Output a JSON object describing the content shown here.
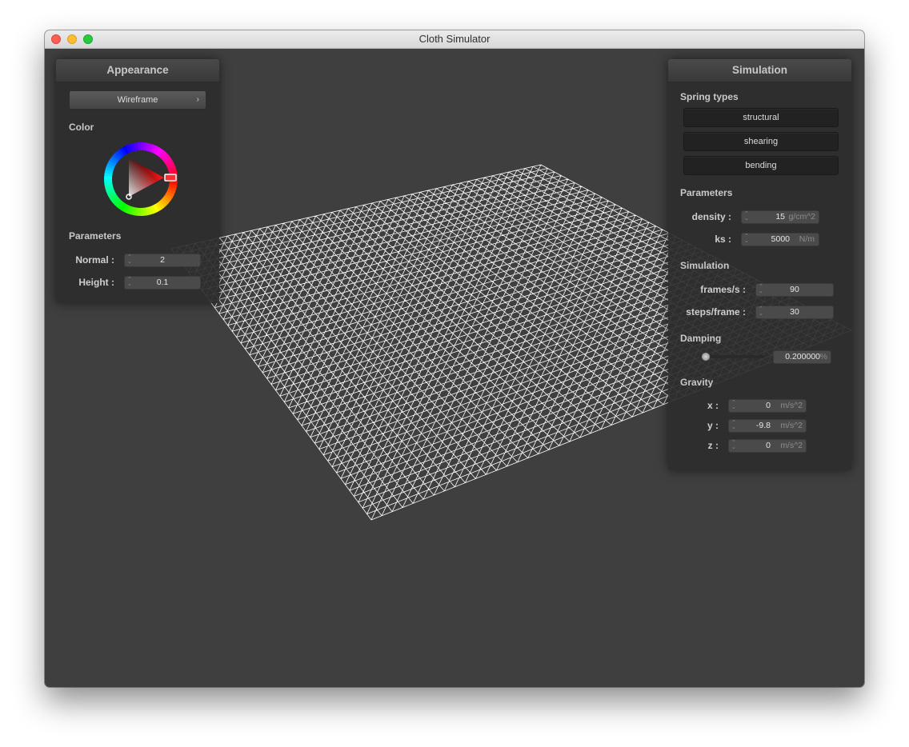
{
  "window": {
    "title": "Cloth Simulator"
  },
  "appearance": {
    "title": "Appearance",
    "shader_select": "Wireframe",
    "color_label": "Color",
    "params_label": "Parameters",
    "normal": {
      "label": "Normal :",
      "value": "2"
    },
    "height": {
      "label": "Height :",
      "value": "0.1"
    }
  },
  "simulation": {
    "title": "Simulation",
    "spring_types_label": "Spring types",
    "springs": [
      "structural",
      "shearing",
      "bending"
    ],
    "params_label": "Parameters",
    "density": {
      "label": "density :",
      "value": "15",
      "unit": "g/cm^2"
    },
    "ks": {
      "label": "ks :",
      "value": "5000",
      "unit": "N/m"
    },
    "sim_label": "Simulation",
    "frames": {
      "label": "frames/s :",
      "value": "90"
    },
    "steps": {
      "label": "steps/frame :",
      "value": "30"
    },
    "damping_label": "Damping",
    "damping": {
      "value": "0.200000",
      "unit": "%"
    },
    "gravity_label": "Gravity",
    "gx": {
      "label": "x :",
      "value": "0",
      "unit": "m/s^2"
    },
    "gy": {
      "label": "y :",
      "value": "-9.8",
      "unit": "m/s^2"
    },
    "gz": {
      "label": "z :",
      "value": "0",
      "unit": "m/s^2"
    }
  },
  "colors": {
    "wireframe": "#ffffff",
    "background": "#3f3f3f",
    "selected_color": "#ff2020"
  }
}
